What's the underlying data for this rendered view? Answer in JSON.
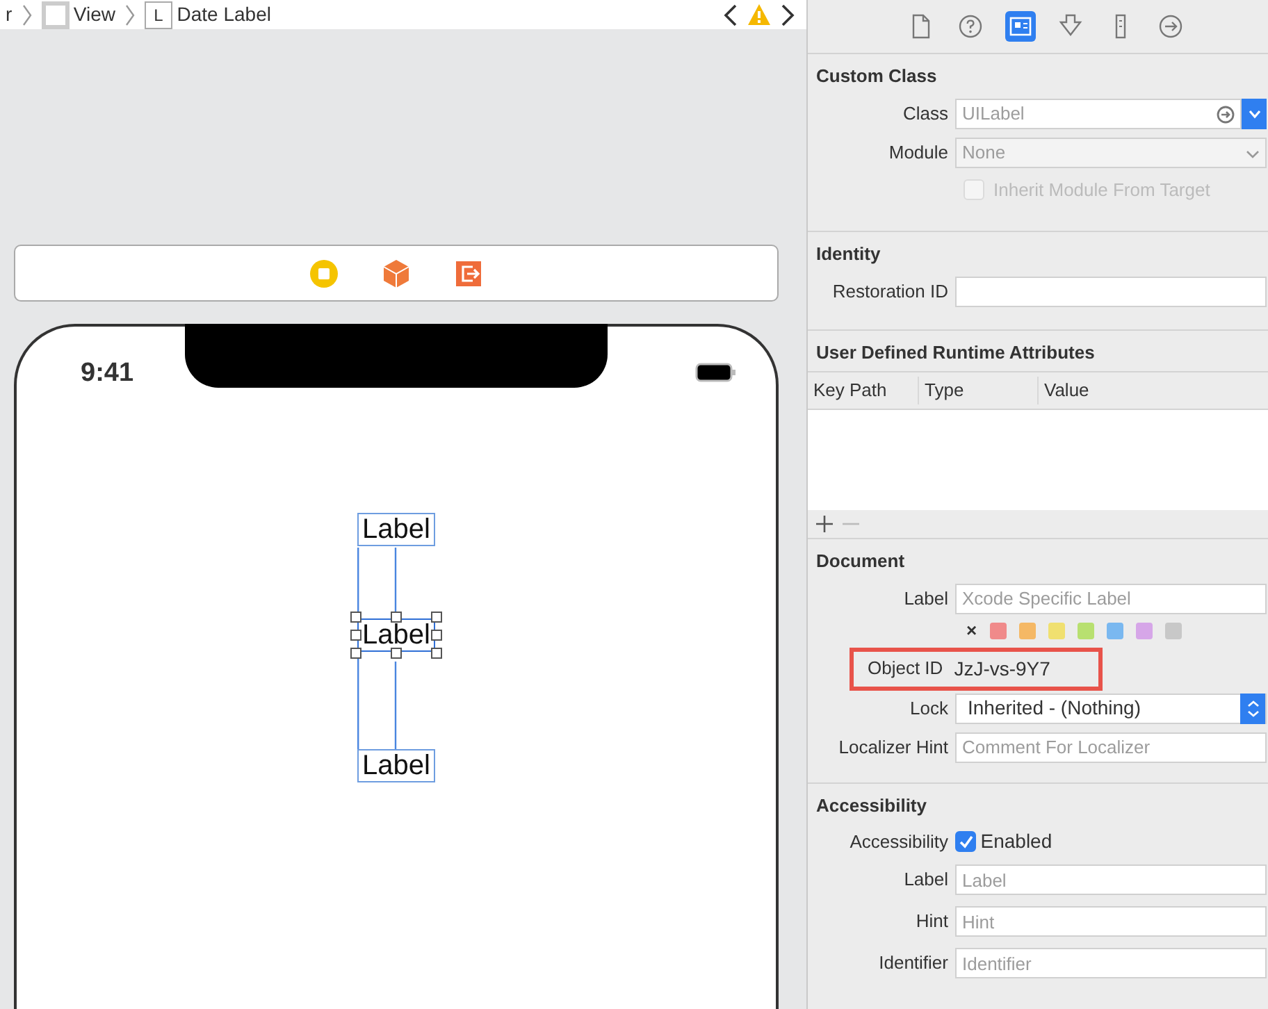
{
  "breadcrumb": [
    {
      "kind": "text",
      "text": "r"
    },
    {
      "kind": "view",
      "text": "View"
    },
    {
      "kind": "label",
      "badge": "L",
      "text": "Date Label"
    }
  ],
  "phone": {
    "time": "9:41",
    "labels": [
      {
        "text": "Label",
        "selected": false
      },
      {
        "text": "Label",
        "selected": true
      },
      {
        "text": "Label",
        "selected": false
      }
    ]
  },
  "inspector_tabs": [
    {
      "kind": "file",
      "selected": false
    },
    {
      "kind": "help",
      "selected": false
    },
    {
      "kind": "identity",
      "selected": true
    },
    {
      "kind": "attributes",
      "selected": false
    },
    {
      "kind": "size",
      "selected": false
    },
    {
      "kind": "connections",
      "selected": false
    }
  ],
  "custom_class": {
    "title": "Custom Class",
    "class_field": {
      "label": "Class",
      "placeholder": "UILabel"
    },
    "module_field": {
      "label": "Module",
      "placeholder": "None"
    },
    "inherit": {
      "label": "Inherit Module From Target",
      "checked": false,
      "disabled": true
    }
  },
  "identity": {
    "title": "Identity",
    "restoration_id": {
      "label": "Restoration ID"
    }
  },
  "runtime_attributes": {
    "title": "User Defined Runtime Attributes",
    "columns": [
      "Key Path",
      "Type",
      "Value"
    ]
  },
  "document": {
    "title": "Document",
    "label_field": {
      "label": "Label",
      "placeholder": "Xcode Specific Label"
    },
    "swatches": [
      {
        "kind": "none",
        "text": "×"
      },
      {
        "kind": "color",
        "color": "#f08a8a"
      },
      {
        "kind": "color",
        "color": "#f5b865"
      },
      {
        "kind": "color",
        "color": "#f0e070"
      },
      {
        "kind": "color",
        "color": "#b8e070"
      },
      {
        "kind": "color",
        "color": "#7ab8f0"
      },
      {
        "kind": "color",
        "color": "#d6a6e8"
      },
      {
        "kind": "color",
        "color": "#c8c8c8"
      }
    ],
    "object_id": {
      "label": "Object ID",
      "value": "JzJ-vs-9Y7",
      "highlighted": true
    },
    "lock": {
      "label": "Lock",
      "value": "Inherited - (Nothing)"
    },
    "localizer_hint": {
      "label": "Localizer Hint",
      "placeholder": "Comment For Localizer"
    }
  },
  "accessibility": {
    "title": "Accessibility",
    "enabled": {
      "label": "Accessibility",
      "text": "Enabled",
      "checked": true
    },
    "fields": [
      {
        "label": "Label",
        "placeholder": "Label"
      },
      {
        "label": "Hint",
        "placeholder": "Hint"
      },
      {
        "label": "Identifier",
        "placeholder": "Identifier"
      }
    ]
  }
}
